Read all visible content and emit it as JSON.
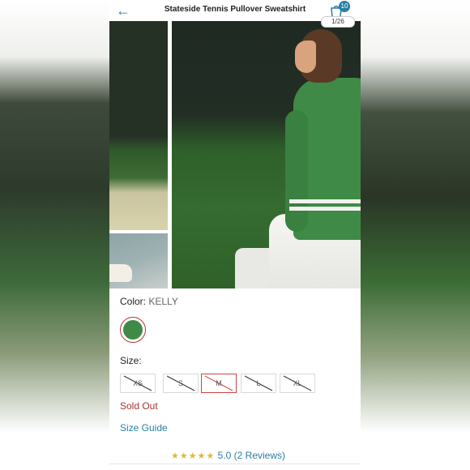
{
  "header": {
    "title": "Stateside Tennis Pullover Sweatshirt",
    "cart_count": "10",
    "zoom_pill": "1/26"
  },
  "product": {
    "color_label": "Color:",
    "color_value": "KELLY",
    "swatch_color": "#3f8a46",
    "size_label": "Size:",
    "sizes": [
      "XS",
      "S",
      "M",
      "L",
      "XL"
    ],
    "selected_size": "M",
    "availability": "Sold Out",
    "size_guide": "Size Guide",
    "rating_stars": "★★★★★",
    "rating_text": "5.0 (2 Reviews)"
  },
  "colors": {
    "accent": "#2a7fa6",
    "sold_out": "#a33333",
    "star": "#e0b83a"
  }
}
